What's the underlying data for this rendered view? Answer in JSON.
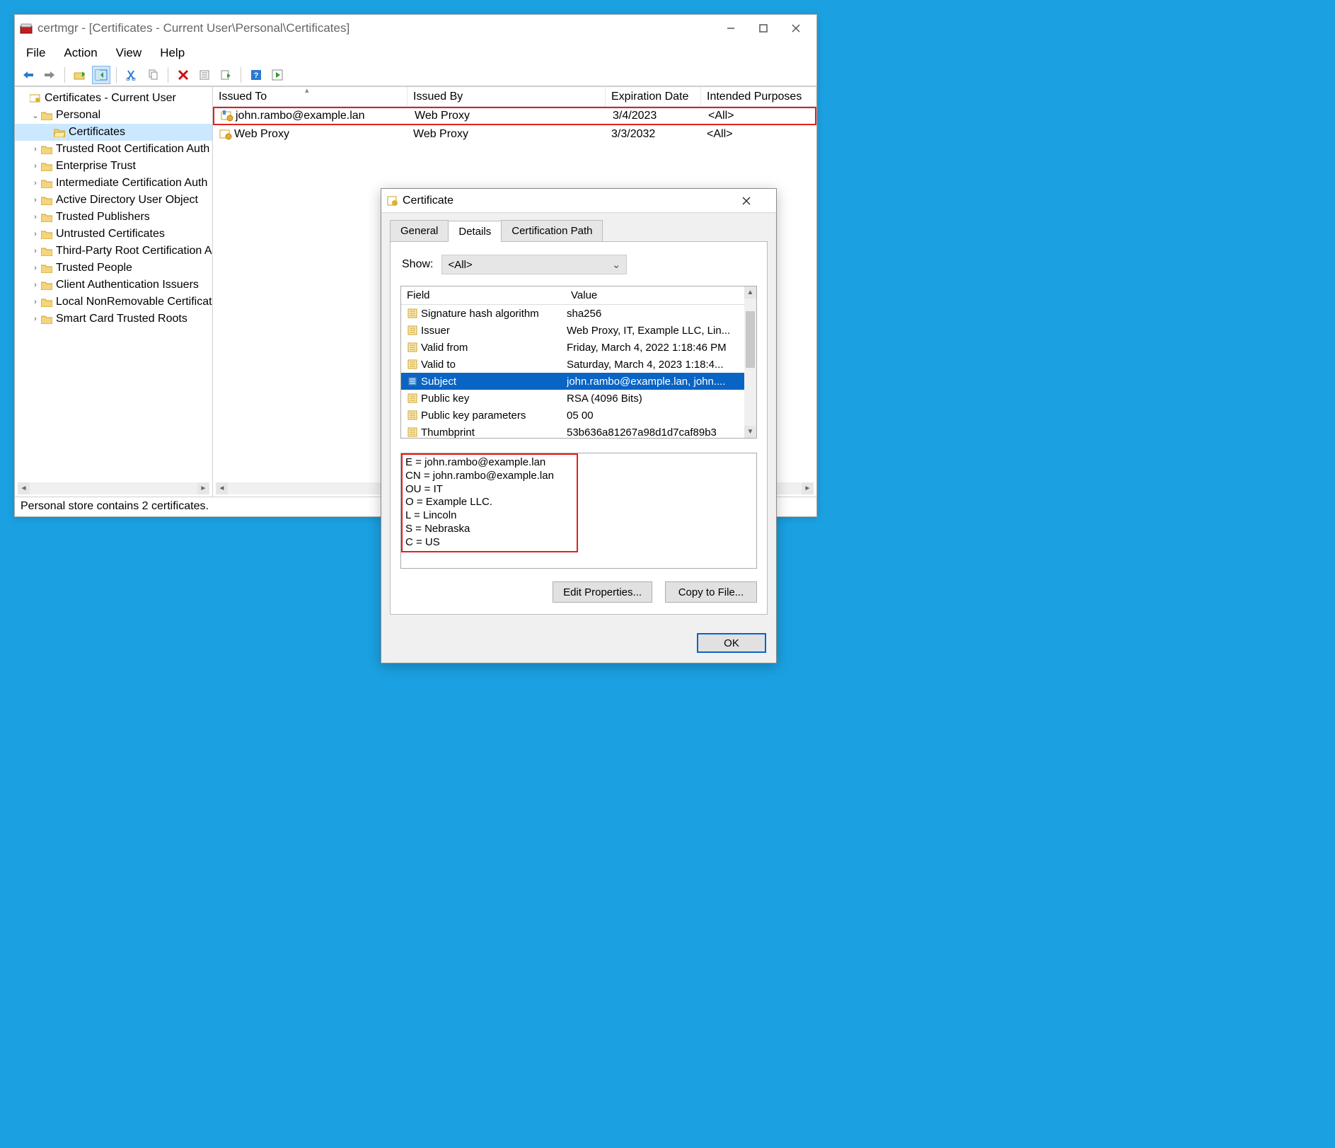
{
  "window": {
    "title": "certmgr - [Certificates - Current User\\Personal\\Certificates]",
    "status": "Personal store contains 2 certificates."
  },
  "menu": {
    "file": "File",
    "action": "Action",
    "view": "View",
    "help": "Help"
  },
  "tree": {
    "root": "Certificates - Current User",
    "personal": "Personal",
    "certificates": "Certificates",
    "items": [
      "Trusted Root Certification Auth",
      "Enterprise Trust",
      "Intermediate Certification Auth",
      "Active Directory User Object",
      "Trusted Publishers",
      "Untrusted Certificates",
      "Third-Party Root Certification A",
      "Trusted People",
      "Client Authentication Issuers",
      "Local NonRemovable Certificat",
      "Smart Card Trusted Roots"
    ]
  },
  "list": {
    "headers": {
      "issued_to": "Issued To",
      "issued_by": "Issued By",
      "expiration": "Expiration Date",
      "purposes": "Intended Purposes"
    },
    "rows": [
      {
        "issued_to": "john.rambo@example.lan",
        "issued_by": "Web Proxy",
        "expiration": "3/4/2023",
        "purposes": "<All>"
      },
      {
        "issued_to": "Web Proxy",
        "issued_by": "Web Proxy",
        "expiration": "3/3/2032",
        "purposes": "<All>"
      }
    ]
  },
  "cert_dialog": {
    "title": "Certificate",
    "tabs": {
      "general": "General",
      "details": "Details",
      "path": "Certification Path"
    },
    "show_label": "Show:",
    "show_value": "<All>",
    "fields_header": {
      "field": "Field",
      "value": "Value"
    },
    "fields": [
      {
        "label": "Signature hash algorithm",
        "value": "sha256"
      },
      {
        "label": "Issuer",
        "value": "Web Proxy, IT, Example LLC, Lin..."
      },
      {
        "label": "Valid from",
        "value": "Friday, March 4, 2022 1:18:46 PM"
      },
      {
        "label": "Valid to",
        "value": "Saturday, March 4, 2023 1:18:4..."
      },
      {
        "label": "Subject",
        "value": "john.rambo@example.lan, john...."
      },
      {
        "label": "Public key",
        "value": "RSA (4096 Bits)"
      },
      {
        "label": "Public key parameters",
        "value": "05 00"
      },
      {
        "label": "Thumbprint",
        "value": "53b636a81267a98d1d7caf89b3"
      }
    ],
    "selected_index": 4,
    "detail_text": "E = john.rambo@example.lan\nCN = john.rambo@example.lan\nOU = IT\nO = Example LLC.\nL = Lincoln\nS = Nebraska\nC = US",
    "buttons": {
      "edit": "Edit Properties...",
      "copy": "Copy to File...",
      "ok": "OK"
    }
  }
}
